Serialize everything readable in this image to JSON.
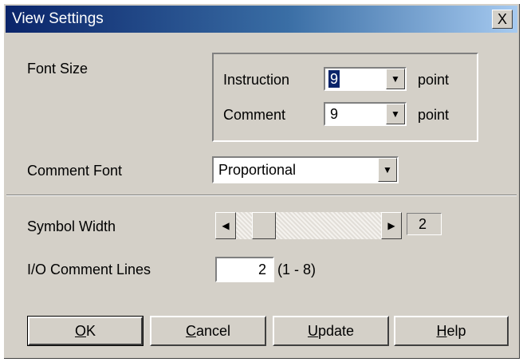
{
  "window": {
    "title": "View Settings",
    "close_glyph": "X"
  },
  "font_size": {
    "label": "Font Size",
    "instruction": {
      "label": "Instruction",
      "value": "9",
      "unit": "point"
    },
    "comment": {
      "label": "Comment",
      "value": "9",
      "unit": "point"
    }
  },
  "comment_font": {
    "label": "Comment Font",
    "value": "Proportional"
  },
  "symbol_width": {
    "label": "Symbol Width",
    "value": "2",
    "left_glyph": "◀",
    "right_glyph": "▶"
  },
  "io_comment_lines": {
    "label": "I/O Comment Lines",
    "value": "2",
    "range": "(1 - 8)"
  },
  "buttons": {
    "ok": {
      "mnemonic": "O",
      "rest": "K"
    },
    "cancel": {
      "mnemonic": "C",
      "rest": "ancel"
    },
    "update": {
      "mnemonic": "U",
      "rest": "pdate"
    },
    "help": {
      "mnemonic": "H",
      "rest": "elp"
    }
  },
  "icons": {
    "dropdown": "chevron-down-icon",
    "close": "close-icon"
  },
  "colors": {
    "titlebar_start": "#0a246a",
    "titlebar_end": "#a6caf0",
    "face": "#d4d0c8",
    "selection": "#0a246a"
  }
}
